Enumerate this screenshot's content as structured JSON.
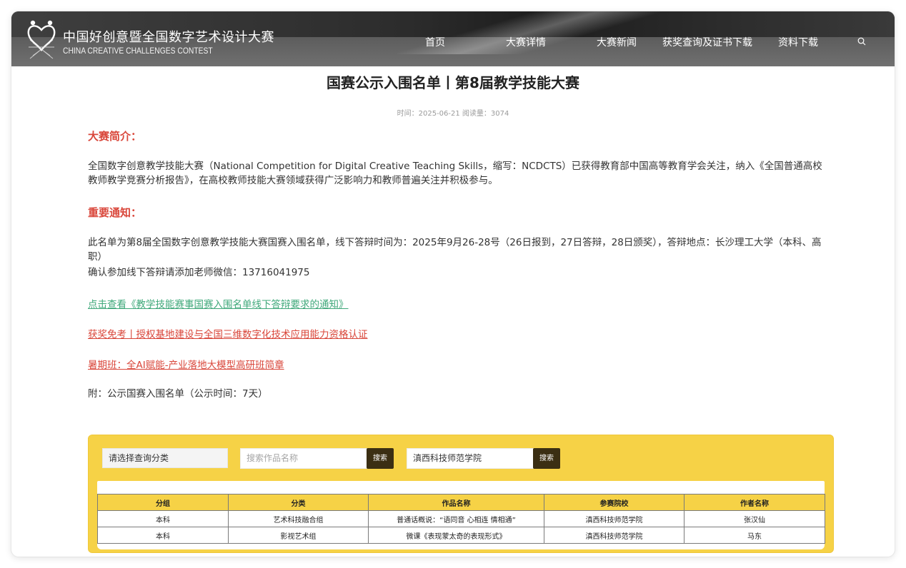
{
  "header": {
    "brand_cn": "中国好创意暨全国数字艺术设计大赛",
    "brand_en": "CHINA CREATIVE CHALLENGES CONTEST",
    "nav": [
      "首页",
      "大赛详情",
      "大赛新闻",
      "获奖查询及证书下载",
      "资料下载"
    ],
    "search_icon": "search-icon"
  },
  "article": {
    "title": "国赛公示入围名单丨第8届教学技能大赛",
    "meta": "时间：2025-06-21 阅读量：3074",
    "intro_heading": "大赛简介：",
    "intro_text": "全国数字创意教学技能大赛（National Competition for Digital Creative Teaching Skills，缩写：NCDCTS）已获得教育部中国高等教育学会关注，纳入《全国普通高校教师教学竞赛分析报告》，在高校教师技能大赛领域获得广泛影响力和教师普遍关注并积极参与。",
    "notice_heading": "重要通知：",
    "notice_text": "此名单为第8届全国数字创意教学技能大赛国赛入围名单，线下答辩时间为：2025年9月26-28号（26日报到，27日答辩，28日颁奖），答辩地点：长沙理工大学（本科、高职）",
    "contact_text": "确认参加线下答辩请添加老师微信：13716041975",
    "link_notice": "点击查看《教学技能赛事国赛入围名单线下答辩要求的通知》",
    "link_award": "获奖免考丨授权基地建设与全国三维数字化技术应用能力资格认证",
    "link_summer": "暑期班：全AI赋能-产业落地大模型高研班简章",
    "appendix": "附：公示国赛入围名单（公示时间：7天）"
  },
  "query": {
    "category_select": "请选择查询分类",
    "work_search_placeholder": "搜索作品名称",
    "search_button": "搜索",
    "school_search_value": "滇西科技师范学院",
    "search_button_2": "搜索"
  },
  "table": {
    "headers": [
      "分组",
      "分类",
      "作品名称",
      "参赛院校",
      "作者名称"
    ],
    "rows": [
      [
        "本科",
        "艺术科技融合组",
        "普通话概说：“语同音 心相连 情相通”",
        "滇西科技师范学院",
        "张汉仙"
      ],
      [
        "本科",
        "影视艺术组",
        "微课《表现蒙太奇的表现形式》",
        "滇西科技师范学院",
        "马东"
      ]
    ]
  },
  "colors": {
    "accent_red": "#d9463a",
    "link_green": "#3fa87a",
    "panel_yellow": "#f6d246",
    "button_dark": "#3b2f13"
  }
}
